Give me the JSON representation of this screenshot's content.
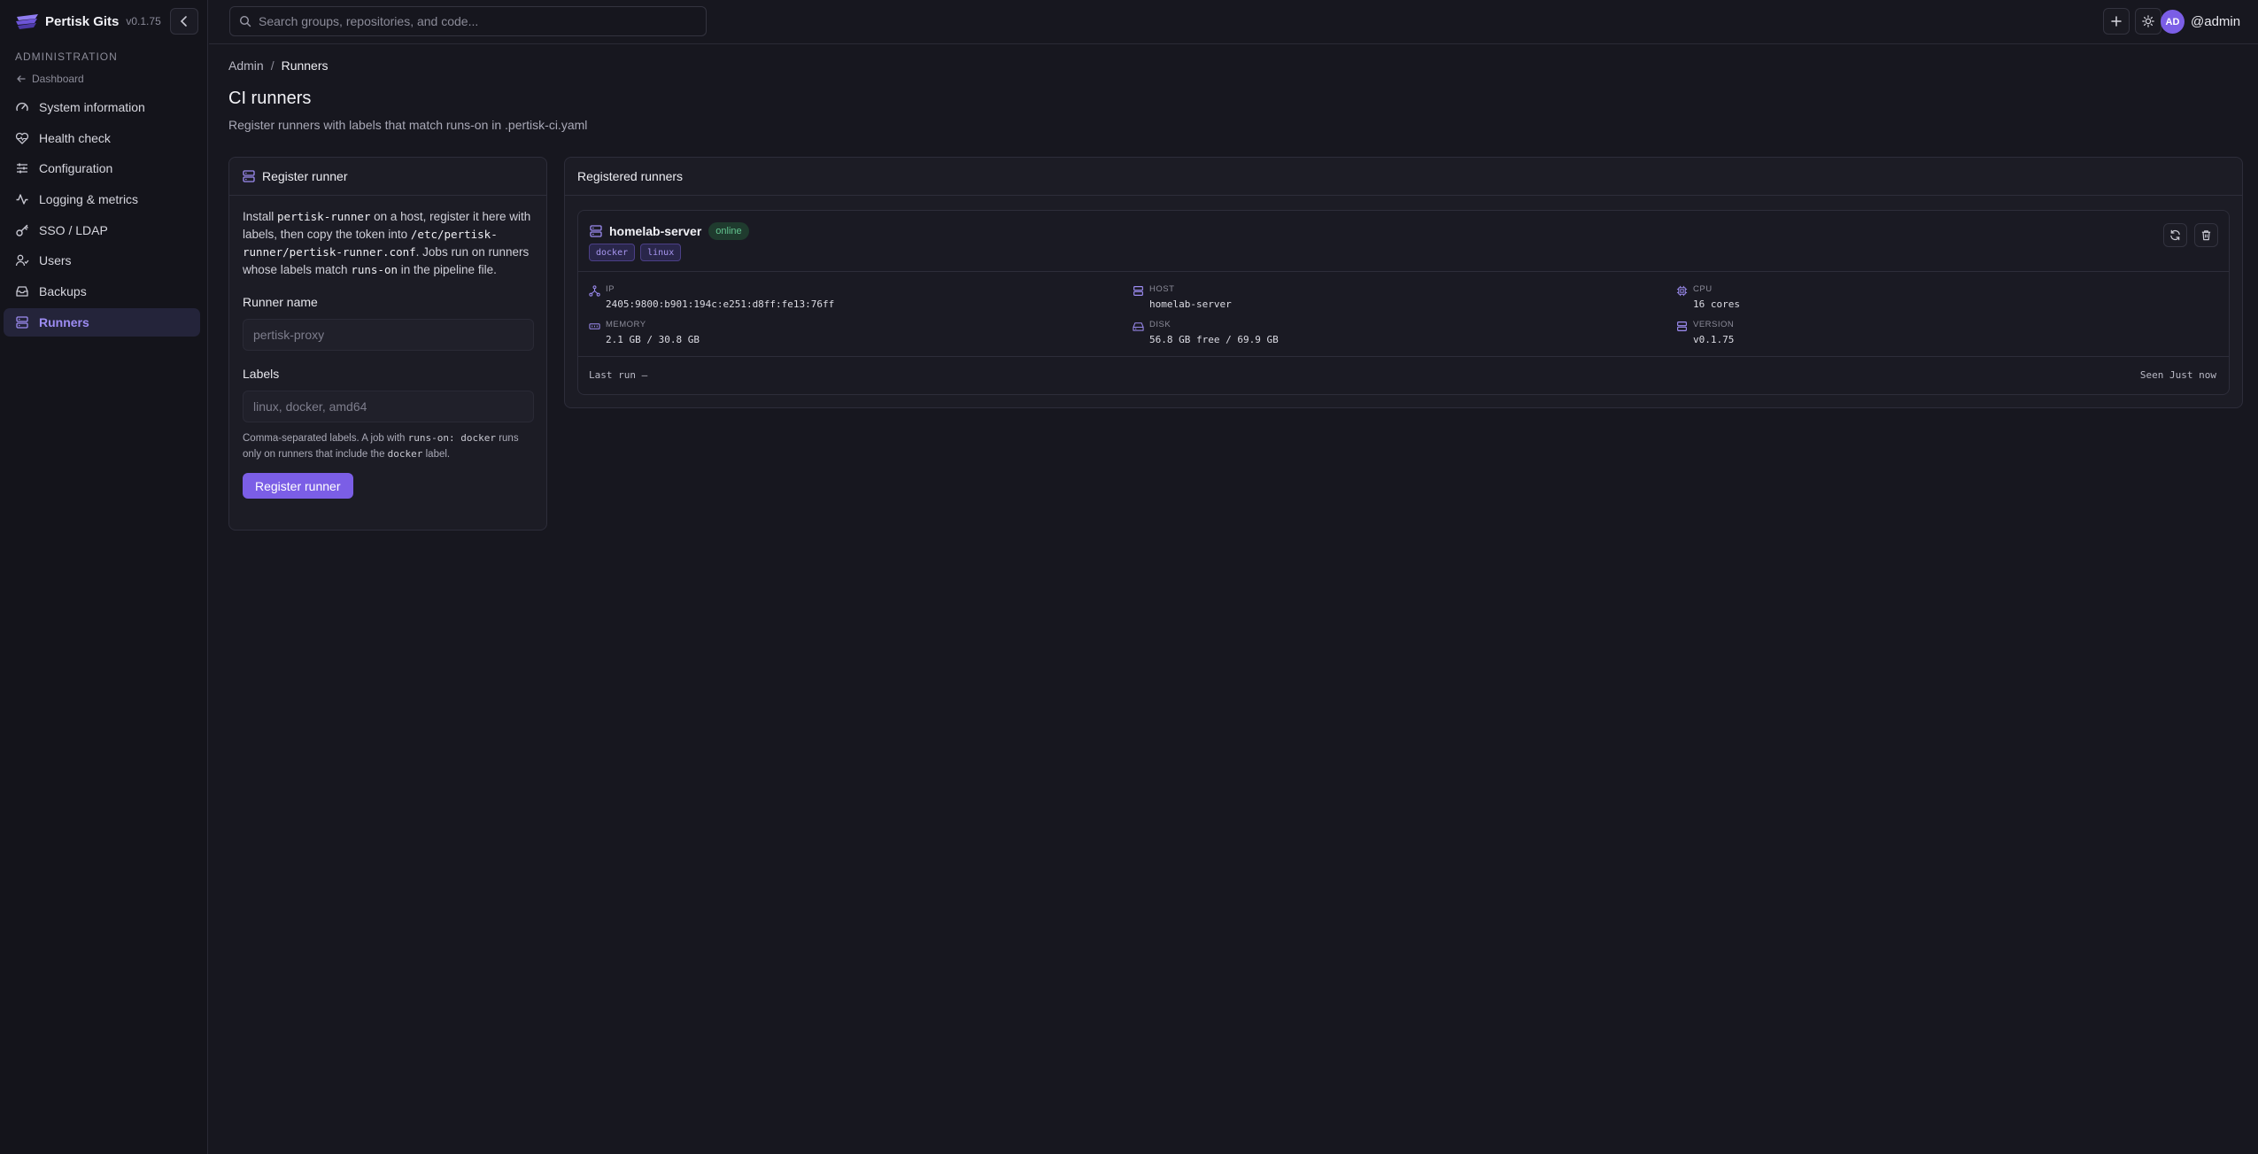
{
  "app": {
    "name": "Pertisk Gits",
    "version": "v0.1.75"
  },
  "sidebar": {
    "section_label": "ADMINISTRATION",
    "back_label": "Dashboard",
    "items": [
      {
        "label": "System information",
        "icon": "gauge-icon",
        "active": false
      },
      {
        "label": "Health check",
        "icon": "heart-pulse-icon",
        "active": false
      },
      {
        "label": "Configuration",
        "icon": "sliders-icon",
        "active": false
      },
      {
        "label": "Logging & metrics",
        "icon": "activity-icon",
        "active": false
      },
      {
        "label": "SSO / LDAP",
        "icon": "key-icon",
        "active": false
      },
      {
        "label": "Users",
        "icon": "users-icon",
        "active": false
      },
      {
        "label": "Backups",
        "icon": "archive-icon",
        "active": false
      },
      {
        "label": "Runners",
        "icon": "server-icon",
        "active": true
      }
    ]
  },
  "topbar": {
    "search_placeholder": "Search groups, repositories, and code...",
    "avatar_initials": "AD",
    "username": "@admin"
  },
  "page": {
    "breadcrumb": [
      "Admin",
      "Runners"
    ],
    "title": "CI runners",
    "subtitle": "Register runners with labels that match runs-on in .pertisk-ci.yaml"
  },
  "register": {
    "title": "Register runner",
    "intro": {
      "p1": "Install ",
      "code1": "pertisk-runner",
      "p2": " on a host, register it here with labels, then copy the token into ",
      "code2": "/etc/pertisk-runner/pertisk-runner.conf",
      "p3": ". Jobs run on runners whose labels match ",
      "code3": "runs-on",
      "p4": " in the pipeline file."
    },
    "name_label": "Runner name",
    "name_placeholder": "pertisk-proxy",
    "labels_label": "Labels",
    "labels_placeholder": "linux, docker, amd64",
    "help": {
      "p1": "Comma-separated labels. A job with ",
      "code1": "runs-on: docker",
      "p2": " runs only on runners that include the ",
      "code2": "docker",
      "p3": " label."
    },
    "button": "Register runner"
  },
  "registered": {
    "title": "Registered runners",
    "runner": {
      "name": "homelab-server",
      "status": "online",
      "tags": [
        "docker",
        "linux"
      ],
      "stats": {
        "ip": {
          "label": "IP",
          "value": "2405:9800:b901:194c:e251:d8ff:fe13:76ff"
        },
        "host": {
          "label": "HOST",
          "value": "homelab-server"
        },
        "cpu": {
          "label": "CPU",
          "value": "16 cores"
        },
        "memory": {
          "label": "MEMORY",
          "value": "2.1 GB / 30.8 GB"
        },
        "disk": {
          "label": "DISK",
          "value": "56.8 GB free / 69.9 GB"
        },
        "version": {
          "label": "VERSION",
          "value": "v0.1.75"
        }
      },
      "last_run": "Last run —",
      "seen": "Seen Just now"
    }
  },
  "colors": {
    "accent": "#7b5ee6",
    "background": "#17171f",
    "online": "#62c48f"
  }
}
